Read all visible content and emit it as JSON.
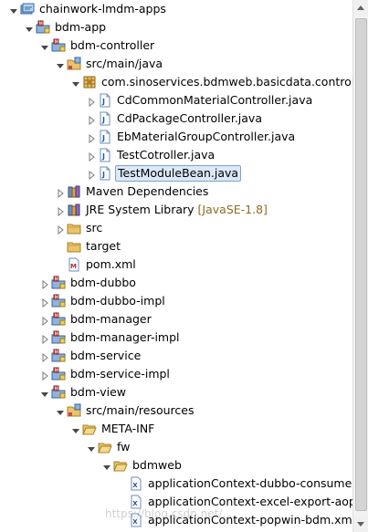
{
  "explorer": {
    "rows": [
      {
        "label": "chainwork-lmdm-apps",
        "icon": "project-working-set-icon",
        "toggle": "expanded"
      },
      {
        "label": "bdm-app",
        "icon": "maven-project-icon",
        "toggle": "expanded"
      },
      {
        "label": "bdm-controller",
        "icon": "maven-project-icon",
        "toggle": "expanded"
      },
      {
        "label": "src/main/java",
        "icon": "source-folder-icon",
        "toggle": "expanded"
      },
      {
        "label": "com.sinoservices.bdmweb.basicdata.controller",
        "icon": "package-icon",
        "toggle": "expanded"
      },
      {
        "label": "CdCommonMaterialController.java",
        "icon": "java-file-icon",
        "toggle": "collapsed"
      },
      {
        "label": "CdPackageController.java",
        "icon": "java-file-icon",
        "toggle": "collapsed"
      },
      {
        "label": "EbMaterialGroupController.java",
        "icon": "java-file-icon",
        "toggle": "collapsed"
      },
      {
        "label": "TestCotroller.java",
        "icon": "java-file-icon",
        "toggle": "collapsed"
      },
      {
        "label": "TestModuleBean.java",
        "icon": "java-file-icon",
        "toggle": "collapsed",
        "selected": true
      },
      {
        "label": "Maven Dependencies",
        "icon": "library-icon",
        "toggle": "collapsed"
      },
      {
        "label": "JRE System Library",
        "suffix": "[JavaSE-1.8]",
        "icon": "library-icon",
        "toggle": "collapsed"
      },
      {
        "label": "src",
        "icon": "folder-icon",
        "toggle": "collapsed"
      },
      {
        "label": "target",
        "icon": "folder-icon",
        "toggle": "none"
      },
      {
        "label": "pom.xml",
        "icon": "pom-file-icon",
        "toggle": "none"
      },
      {
        "label": "bdm-dubbo",
        "icon": "maven-project-icon",
        "toggle": "collapsed"
      },
      {
        "label": "bdm-dubbo-impl",
        "icon": "maven-project-icon",
        "toggle": "collapsed"
      },
      {
        "label": "bdm-manager",
        "icon": "maven-project-icon",
        "toggle": "collapsed"
      },
      {
        "label": "bdm-manager-impl",
        "icon": "maven-project-icon",
        "toggle": "collapsed"
      },
      {
        "label": "bdm-service",
        "icon": "maven-project-icon",
        "toggle": "collapsed"
      },
      {
        "label": "bdm-service-impl",
        "icon": "maven-project-icon",
        "toggle": "collapsed"
      },
      {
        "label": "bdm-view",
        "icon": "maven-project-icon",
        "toggle": "expanded"
      },
      {
        "label": "src/main/resources",
        "icon": "source-folder-icon",
        "toggle": "expanded"
      },
      {
        "label": "META-INF",
        "icon": "folder-open-icon",
        "toggle": "expanded"
      },
      {
        "label": "fw",
        "icon": "folder-open-icon",
        "toggle": "expanded"
      },
      {
        "label": "bdmweb",
        "icon": "folder-open-icon",
        "toggle": "expanded"
      },
      {
        "label": "applicationContext-dubbo-consumer.xml",
        "icon": "xml-file-icon",
        "toggle": "none"
      },
      {
        "label": "applicationContext-excel-export-aop.xml",
        "icon": "xml-file-icon",
        "toggle": "none"
      },
      {
        "label": "applicationContext-popwin-bdm.xml",
        "icon": "xml-file-icon",
        "toggle": "none"
      }
    ]
  },
  "watermark": "https://blog.csdn.net/...",
  "colors": {
    "selection_bg": "#dbe8f8",
    "selection_border": "#7da2ce",
    "decoration": "#8e6b23"
  }
}
